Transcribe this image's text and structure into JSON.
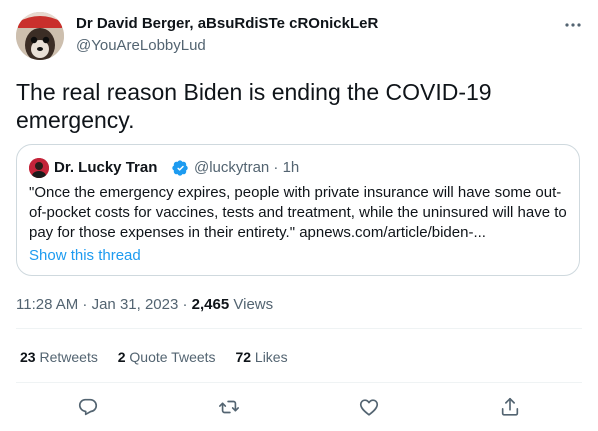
{
  "author": {
    "display_name": "Dr David Berger, aBsuRdiSTe cROnickLeR",
    "handle": "@YouAreLobbyLud"
  },
  "tweet": {
    "text": "The real reason Biden is ending the COVID-19 emergency."
  },
  "quoted_tweet": {
    "display_name": "Dr. Lucky Tran",
    "handle_time": "@luckytran · 1h",
    "text": "\"Once the emergency expires, people with private insurance will have some out-of-pocket costs for vaccines, tests and treatment, while the uninsured will have to pay for those expenses in their entirety.\" apnews.com/article/biden-...",
    "show_thread_label": "Show this thread"
  },
  "meta": {
    "time_date": "11:28 AM · Jan 31, 2023 · ",
    "views_count": "2,465",
    "views_label": " Views"
  },
  "stats": {
    "retweets_count": "23",
    "retweets_label": "Retweets",
    "quote_tweets_count": "2",
    "quote_tweets_label": "Quote Tweets",
    "likes_count": "72",
    "likes_label": "Likes"
  },
  "icons": {
    "more": "more-icon",
    "verified": "verified-badge-icon",
    "reply": "reply-icon",
    "retweet": "retweet-icon",
    "like": "like-icon",
    "share": "share-icon"
  },
  "colors": {
    "text_primary": "#0f1419",
    "text_secondary": "#536471",
    "link": "#1d9bf0",
    "border": "#cfd9de",
    "divider": "#eff3f4"
  }
}
